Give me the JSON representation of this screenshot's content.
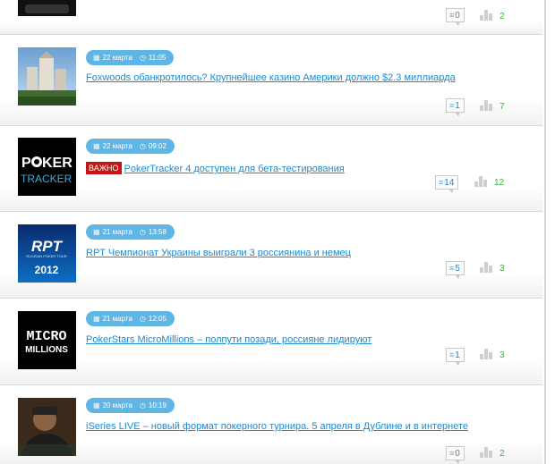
{
  "articles": [
    {
      "date": "",
      "time": "",
      "title": "",
      "important": "",
      "comments": "0",
      "likes": "2"
    },
    {
      "date": "22 марта",
      "time": "11:05",
      "title": "Foxwoods обанкротилось? Крупнейшее казино Америки должно $2.3 миллиарда",
      "important": "",
      "comments": "1",
      "likes": "7",
      "thumb": "casino"
    },
    {
      "date": "22 марта",
      "time": "09:02",
      "title": "PokerTracker 4 доступен для бета-тестирования",
      "important": "ВАЖНО",
      "comments": "14",
      "likes": "12",
      "thumb": "pokertracker",
      "thumb_text": [
        "P",
        "KER",
        "TRACKER"
      ]
    },
    {
      "date": "21 марта",
      "time": "13:58",
      "title": "RPT Чемпионат Украины выиграли 3 россиянина и немец",
      "important": "",
      "comments": "5",
      "likes": "3",
      "thumb": "rpt",
      "thumb_text": [
        "RPT",
        "RUSSIAN POKER TOUR",
        "2012"
      ]
    },
    {
      "date": "21 марта",
      "time": "12:05",
      "title": "PokerStars MicroMillions – полпути позади, россияне лидируют",
      "important": "",
      "comments": "1",
      "likes": "3",
      "thumb": "micromillions",
      "thumb_text": [
        "MICRO",
        "MILLIONS"
      ]
    },
    {
      "date": "20 марта",
      "time": "10:19",
      "title": "iSeries LIVE – новый формат покерного турнира. 5 апреля в Дублине и в интернете",
      "important": "",
      "comments": "0",
      "likes": "2",
      "thumb": "player"
    }
  ],
  "icons": {
    "calendar": "calendar-icon",
    "clock": "clock-icon",
    "comments": "comment-icon",
    "likes": "likes-icon"
  },
  "colors": {
    "pill": "#5fb6e4",
    "link": "#1a8ad1",
    "important": "#c41414",
    "likes": "#3cb53c"
  }
}
